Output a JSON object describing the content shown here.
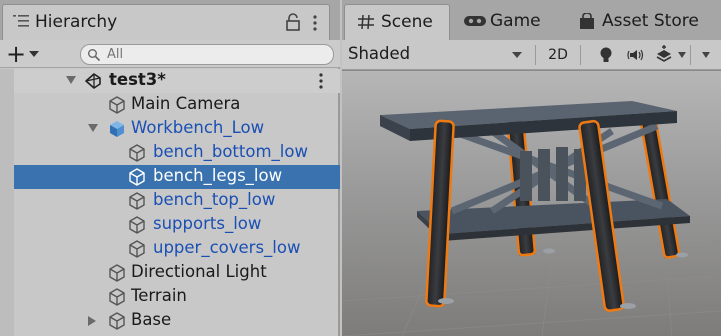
{
  "hierarchy": {
    "tab_title": "Hierarchy",
    "search_placeholder": "All",
    "rows": [
      {
        "label": "test3*"
      },
      {
        "label": "Main Camera"
      },
      {
        "label": "Workbench_Low"
      },
      {
        "label": "bench_bottom_low"
      },
      {
        "label": "bench_legs_low"
      },
      {
        "label": "bench_top_low"
      },
      {
        "label": "supports_low"
      },
      {
        "label": "upper_covers_low"
      },
      {
        "label": "Directional Light"
      },
      {
        "label": "Terrain"
      },
      {
        "label": "Base"
      }
    ]
  },
  "scene": {
    "tabs": [
      {
        "label": "Scene",
        "icon": "grid-hash-icon"
      },
      {
        "label": "Game",
        "icon": "gamepad-icon"
      },
      {
        "label": "Asset Store",
        "icon": "shopping-bag-icon"
      }
    ],
    "shading_mode": "Shaded",
    "mode_2d_label": "2D"
  },
  "colors": {
    "selection": "#3a72b0",
    "prefab_text": "#1a4fb4",
    "outline_orange": "#f07a12"
  }
}
